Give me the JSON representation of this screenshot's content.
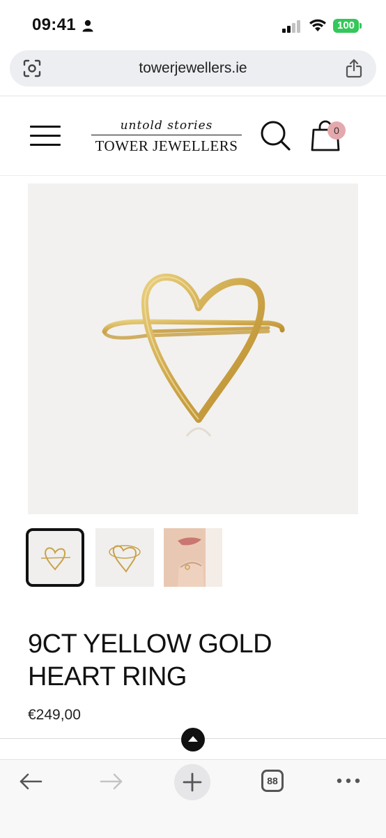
{
  "status_bar": {
    "time": "09:41",
    "battery": "100"
  },
  "browser": {
    "url": "towerjewellers.ie",
    "tab_count": "88"
  },
  "site": {
    "logo_script": "untold stories",
    "logo_main": "TOWER JEWELLERS",
    "cart_count": "0",
    "badge_color": "#e4a9ad"
  },
  "product": {
    "title": "9CT YELLOW GOLD HEART RING",
    "price": "€249,00",
    "thumbnails": [
      "heart-ring-front",
      "heart-ring-angle",
      "heart-ring-worn"
    ],
    "selected_thumbnail": 0
  },
  "colors": {
    "gold": "#d4b25a",
    "image_background": "#f2f1ef",
    "battery_green": "#34c759"
  }
}
